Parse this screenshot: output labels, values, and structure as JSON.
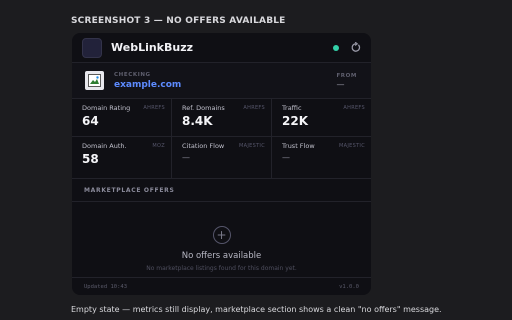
{
  "heading": "SCREENSHOT 3 — NO OFFERS AVAILABLE",
  "app": {
    "name": "WebLinkBuzz",
    "status_color": "#33d0a8",
    "accent_color": "#5d8bff",
    "icons": {
      "logo": "logo-square",
      "status": "status-dot",
      "refresh": "refresh-icon",
      "favicon": "image-icon",
      "empty": "plus-circle-icon"
    }
  },
  "site": {
    "checking_label": "CHECKING",
    "domain": "example.com",
    "from_label": "FROM",
    "from_value": "—"
  },
  "metrics": [
    {
      "label": "Domain Rating",
      "source": "AHREFS",
      "value": "64"
    },
    {
      "label": "Ref. Domains",
      "source": "AHREFS",
      "value": "8.4K"
    },
    {
      "label": "Traffic",
      "source": "AHREFS",
      "value": "22K"
    },
    {
      "label": "Domain Auth.",
      "source": "MOZ",
      "value": "58"
    },
    {
      "label": "Citation Flow",
      "source": "MAJESTIC",
      "value": "—"
    },
    {
      "label": "Trust Flow",
      "source": "MAJESTIC",
      "value": "—"
    }
  ],
  "offers": {
    "title": "MARKETPLACE OFFERS",
    "empty_title": "No offers available",
    "empty_subtitle": "No marketplace listings found for this domain yet."
  },
  "footer": {
    "updated": "Updated 10:43",
    "version": "v1.0.0"
  },
  "caption": "Empty state — metrics still display, marketplace section shows a clean \"no offers\" message."
}
